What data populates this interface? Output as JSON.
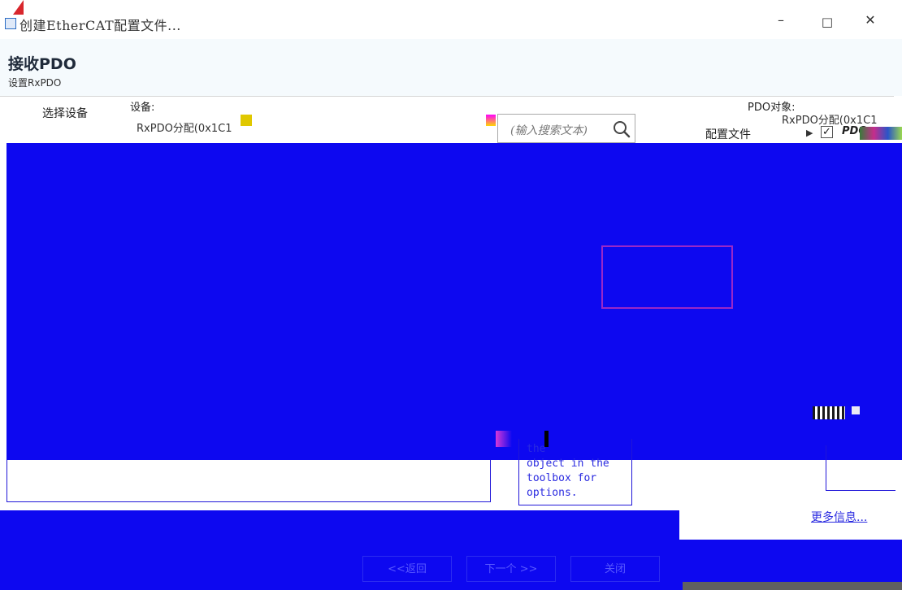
{
  "window": {
    "title": "创建EtherCAT配置文件...",
    "minimize": "–",
    "maximize": "□",
    "close": "✕"
  },
  "header": {
    "title": "接收PDO",
    "subtitle": "设置RxPDO"
  },
  "sidebar": {
    "steps": [
      {
        "label": "选择设备"
      }
    ]
  },
  "device": {
    "label": "设备:",
    "value": "RxPDO分配(0x1C1"
  },
  "search": {
    "placeholder": "(输入搜索文本)"
  },
  "pdo": {
    "label": "PDO对象:",
    "value": "RxPDO分配(0x1C1",
    "profile_label": "配置文件",
    "tree_node": "PDO",
    "checked": true
  },
  "help": {
    "text": "the\nobject in the\ntoolbox for\noptions."
  },
  "links": {
    "more_info": "更多信息..."
  },
  "footer": {
    "back": "<<返回",
    "next": "下一个 >>",
    "close": "关闭"
  }
}
